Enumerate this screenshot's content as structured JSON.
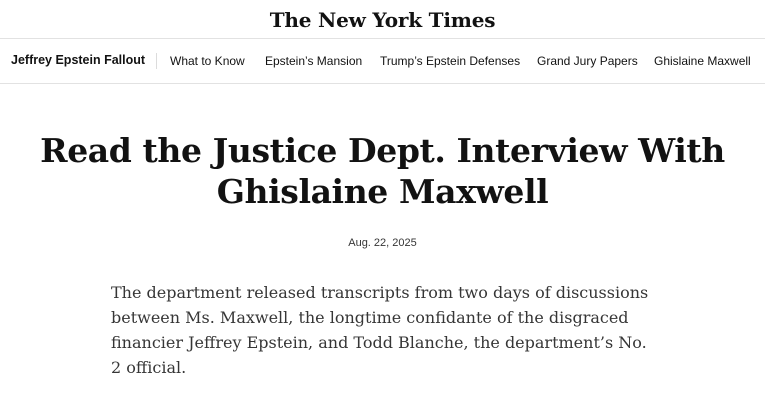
{
  "masthead": {
    "logo_text": "The New York Times"
  },
  "nav": {
    "section_label": "Jeffrey Epstein Fallout",
    "links": [
      "What to Know",
      "Epstein’s Mansion",
      "Trump’s Epstein Defenses",
      "Grand Jury Papers",
      "Ghislaine Maxwell"
    ]
  },
  "article": {
    "headline_line1": "Read the Justice Dept. Interview With",
    "headline_line2": "Ghislaine Maxwell",
    "date": "Aug. 22, 2025",
    "summary": "The department released transcripts from two days of discussions between Ms. Maxwell, the longtime confidante of the disgraced financier Jeffrey Epstein, and Todd Blanche, the department’s No. 2 official."
  }
}
